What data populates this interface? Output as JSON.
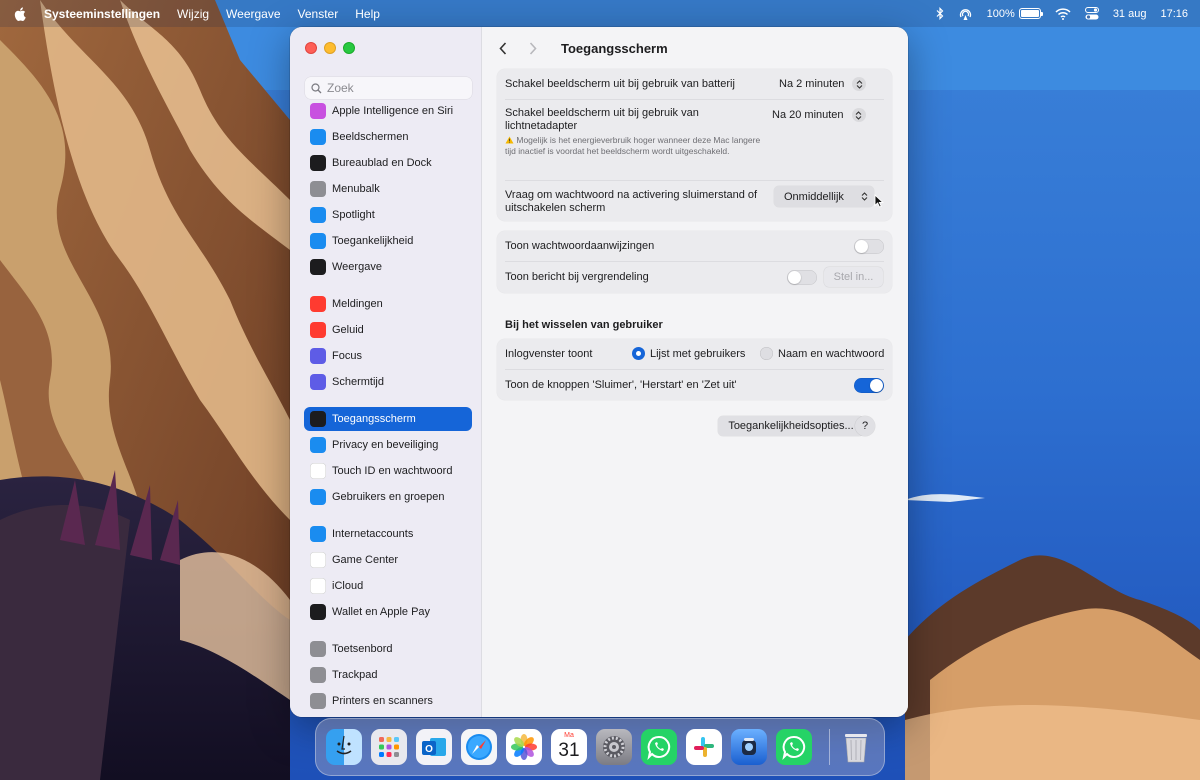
{
  "menubar": {
    "app": "Systeeminstellingen",
    "items": [
      "Wijzig",
      "Weergave",
      "Venster",
      "Help"
    ],
    "battery_percent": "100%",
    "battery_level": 1.0,
    "date": "31 aug",
    "time": "17:16"
  },
  "sidebar": {
    "search_placeholder": "Zoek",
    "items": [
      {
        "label": "Apple Intelligence en Siri",
        "icon": "siri-icon",
        "color": "#c850e0"
      },
      {
        "label": "Beeldschermen",
        "icon": "sun-icon",
        "color": "#1a8cf0"
      },
      {
        "label": "Bureaublad en Dock",
        "icon": "dock-icon",
        "color": "#1c1c1e"
      },
      {
        "label": "Menubalk",
        "icon": "menubar-icon",
        "color": "#8e8e93"
      },
      {
        "label": "Spotlight",
        "icon": "magnifier-icon",
        "color": "#1a8cf0"
      },
      {
        "label": "Toegankelijkheid",
        "icon": "accessibility-icon",
        "color": "#1a8cf0"
      },
      {
        "label": "Weergave",
        "icon": "appearance-icon",
        "color": "#1c1c1e"
      },
      {
        "label": "Meldingen",
        "icon": "bell-icon",
        "color": "#ff3b30"
      },
      {
        "label": "Geluid",
        "icon": "speaker-icon",
        "color": "#ff3b30"
      },
      {
        "label": "Focus",
        "icon": "moon-icon",
        "color": "#5e5ce6"
      },
      {
        "label": "Schermtijd",
        "icon": "hourglass-icon",
        "color": "#5e5ce6"
      },
      {
        "label": "Toegangsscherm",
        "icon": "lock-icon",
        "color": "#1c1c1e"
      },
      {
        "label": "Privacy en beveiliging",
        "icon": "hand-icon",
        "color": "#1a8cf0"
      },
      {
        "label": "Touch ID en wachtwoord",
        "icon": "fingerprint-icon",
        "color": "#ffffff"
      },
      {
        "label": "Gebruikers en groepen",
        "icon": "users-icon",
        "color": "#1a8cf0"
      },
      {
        "label": "Internetaccounts",
        "icon": "at-icon",
        "color": "#1a8cf0"
      },
      {
        "label": "Game Center",
        "icon": "game-center-icon",
        "color": "#ffffff"
      },
      {
        "label": "iCloud",
        "icon": "cloud-icon",
        "color": "#ffffff"
      },
      {
        "label": "Wallet en Apple Pay",
        "icon": "wallet-icon",
        "color": "#1c1c1e"
      },
      {
        "label": "Toetsenbord",
        "icon": "keyboard-icon",
        "color": "#8e8e93"
      },
      {
        "label": "Trackpad",
        "icon": "trackpad-icon",
        "color": "#8e8e93"
      },
      {
        "label": "Printers en scanners",
        "icon": "printer-icon",
        "color": "#8e8e93"
      }
    ]
  },
  "content": {
    "title": "Toegangsscherm",
    "battery_label": "Schakel beeldscherm uit bij gebruik van batterij",
    "battery_value": "Na 2 minuten",
    "adapter_label_line1": "Schakel beeldscherm uit bij gebruik van",
    "adapter_label_line2": "lichtnetadapter",
    "adapter_value": "Na 20 minuten",
    "adapter_note": "Mogelijk is het energieverbruik hoger wanneer deze Mac langere tijd inactief is voordat het beeldscherm wordt uitgeschakeld.",
    "password_label_line1": "Vraag om wachtwoord na activering sluimerstand of",
    "password_label_line2": "uitschakelen scherm",
    "password_value": "Onmiddellijk",
    "hints_label": "Toon wachtwoordaanwijzingen",
    "hints_on": false,
    "lockmsg_label": "Toon bericht bij vergrendeling",
    "lockmsg_on": false,
    "lockmsg_button": "Stel in...",
    "switch_section": "Bij het wisselen van gebruiker",
    "login_label": "Inlogvenster toont",
    "login_option_list": "Lijst met gebruikers",
    "login_option_name": "Naam en wachtwoord",
    "buttons_label": "Toon de knoppen 'Sluimer', 'Herstart' en 'Zet uit'",
    "buttons_on": true,
    "accessibility_button": "Toegankelijkheidsopties...",
    "help_label": "?"
  },
  "dock": {
    "calendar_month": "Ma",
    "calendar_day": "31",
    "apps": [
      "finder-icon",
      "launchpad-icon",
      "outlook-icon",
      "safari-icon",
      "photos-icon",
      "calendar-icon",
      "system-settings-icon",
      "whatsapp-icon",
      "slack-icon",
      "app-icon",
      "whatsapp-beta-icon",
      "trash-icon"
    ]
  },
  "colors": {
    "accent": "#1565d8",
    "close": "#fe5f57",
    "minimize": "#febc2e",
    "maximize": "#28c840"
  }
}
